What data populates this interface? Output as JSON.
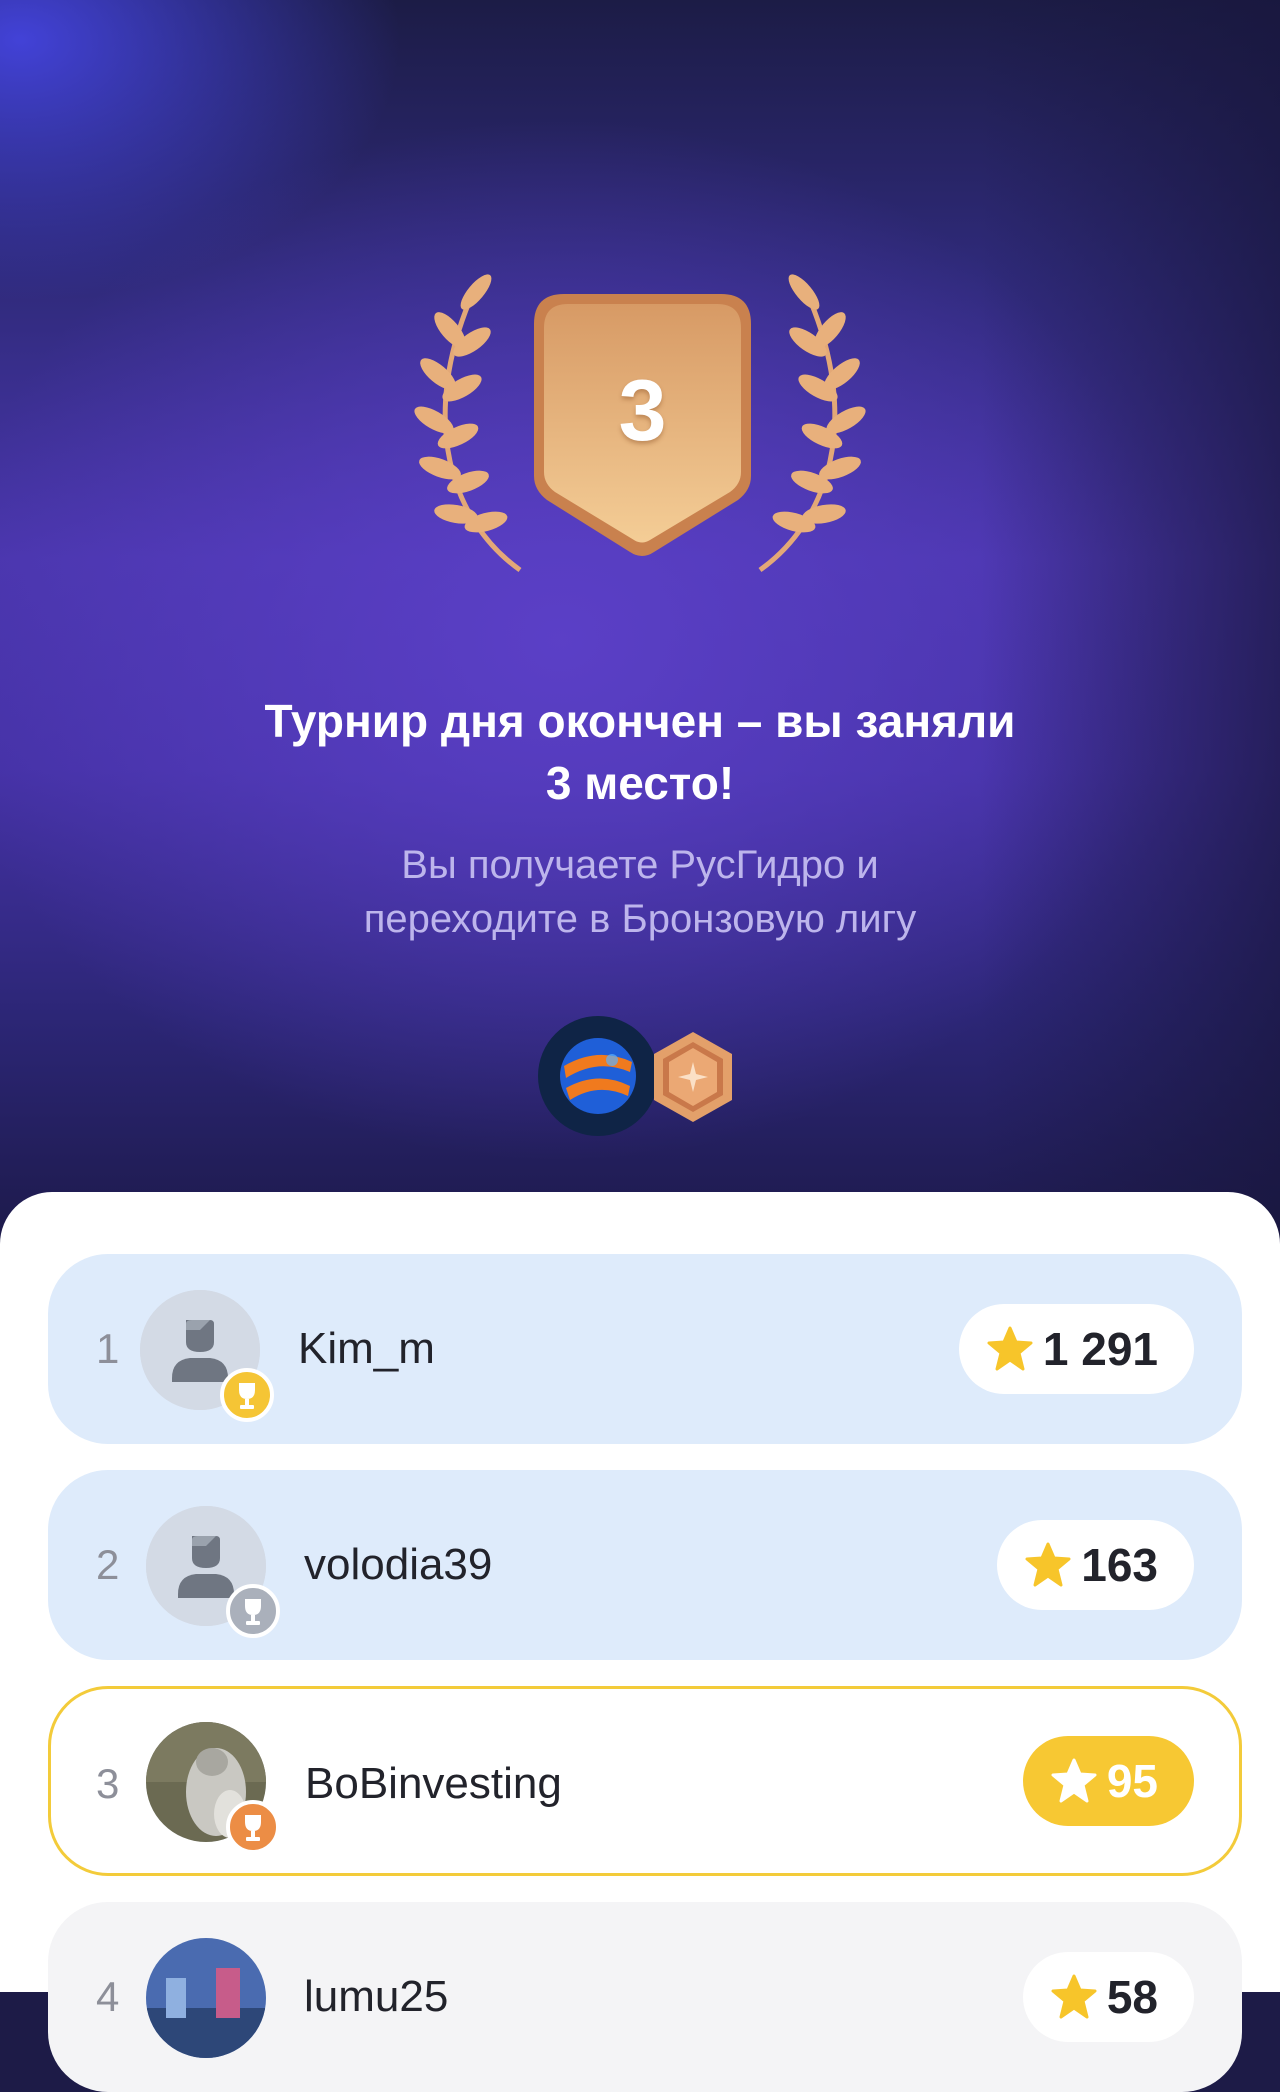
{
  "result": {
    "place_number": "3",
    "headline_line1": "Турнир дня окончен – вы заняли",
    "headline_line2": "3 место!",
    "subtext_line1": "Вы получаете РусГидро и",
    "subtext_line2": "переходите в Бронзовую лигу",
    "rewards": [
      "rushydro-coin-icon",
      "bronze-league-badge-icon"
    ]
  },
  "leaderboard": [
    {
      "rank": "1",
      "name": "Kim_m",
      "score": "1 291",
      "cup": "gold",
      "highlight": "leader"
    },
    {
      "rank": "2",
      "name": "volodia39",
      "score": "163",
      "cup": "silver",
      "highlight": "leader"
    },
    {
      "rank": "3",
      "name": "BoBinvesting",
      "score": "95",
      "cup": "bronze",
      "highlight": "me"
    },
    {
      "rank": "4",
      "name": "lumu25",
      "score": "58",
      "cup": "",
      "highlight": "other"
    }
  ],
  "colors": {
    "accent_yellow": "#f7c833",
    "hero_purple": "#4a36ad",
    "leader_row": "#deebfb",
    "bronze": "#e3a06a"
  }
}
